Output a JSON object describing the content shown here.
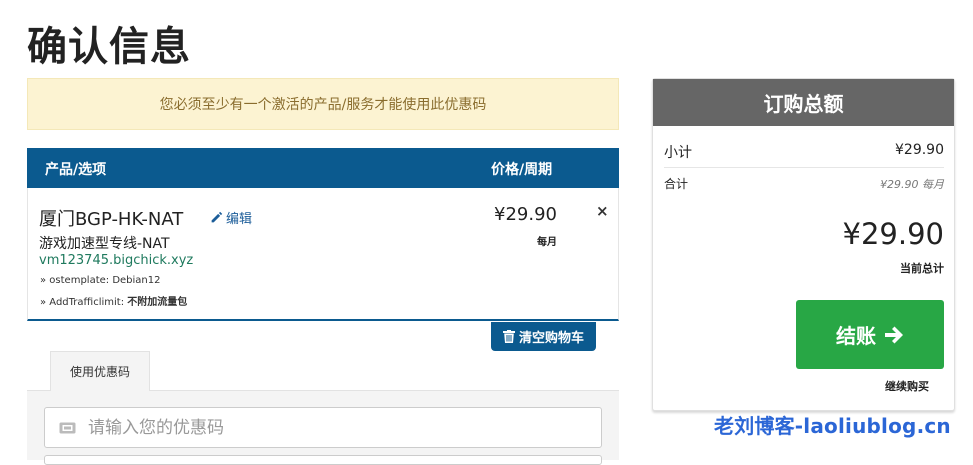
{
  "page_title": "确认信息",
  "alert_text": "您必须至少有一个激活的产品/服务才能使用此优惠码",
  "cart": {
    "col_product": "产品/选项",
    "col_price": "价格/周期",
    "item": {
      "name": "厦门BGP-HK-NAT",
      "edit_label": "编辑",
      "group": "游戏加速型专线-NAT",
      "domain": "vm123745.bigchick.xyz",
      "option1": "» ostemplate: Debian12",
      "option2_label": "» AddTrafficlimit:",
      "option2_value": "不附加流量包",
      "price": "¥29.90",
      "cycle": "每月",
      "remove_icon": "×"
    },
    "empty_label": "清空购物车"
  },
  "promo": {
    "tab_label": "使用优惠码",
    "placeholder": "请输入您的优惠码"
  },
  "summary": {
    "title": "订购总额",
    "subtotal_label": "小计",
    "subtotal_value": "¥29.90",
    "totals_label": "合计",
    "totals_value": "¥29.90 每月",
    "total_amount": "¥29.90",
    "total_label": "当前总计",
    "checkout_label": "结账",
    "continue_label": "继续购买"
  },
  "watermark": "老刘博客-laoliublog.cn",
  "colors": {
    "header_blue": "#0b5a8f",
    "checkout_green": "#28a745",
    "summary_gray": "#666666",
    "alert_bg": "#fcf3d2"
  },
  "icons": [
    "pencil-icon",
    "close-icon",
    "trash-icon",
    "ticket-icon",
    "arrow-right-icon"
  ]
}
